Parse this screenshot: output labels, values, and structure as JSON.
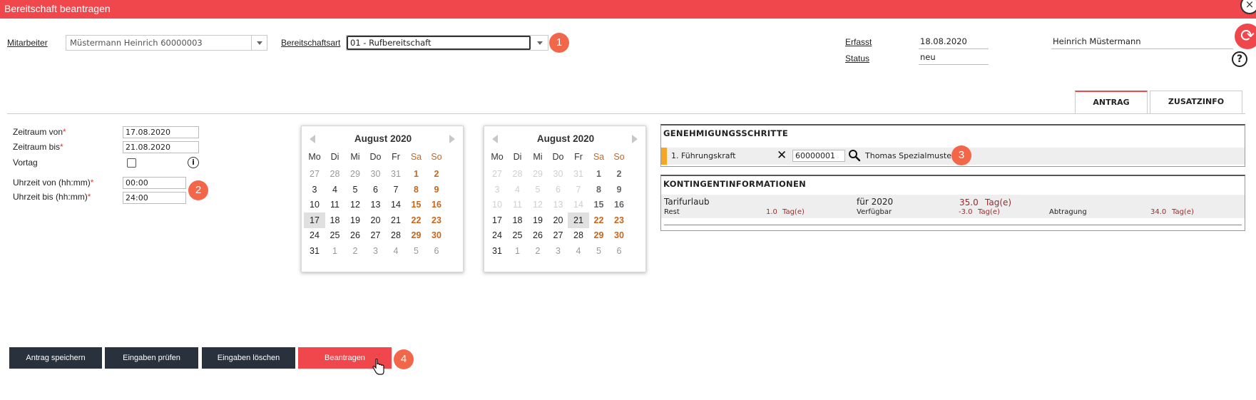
{
  "window": {
    "title": "Bereitschaft beantragen",
    "close_glyph": "×",
    "refresh_glyph": "⟳",
    "help_glyph": "?"
  },
  "header": {
    "mitarbeiter_label": "Mitarbeiter",
    "mitarbeiter_value": "Müstermann Heinrich 60000003",
    "art_label": "Bereitschaftsart",
    "art_value": "01 - Rufbereitschaft",
    "erfasst_label": "Erfasst",
    "erfasst_value": "18.08.2020",
    "status_label": "Status",
    "status_value": "neu",
    "user_name": "Heinrich Müstermann"
  },
  "badges": [
    "1",
    "2",
    "3",
    "4"
  ],
  "tabs": [
    {
      "label": "ANTRAG",
      "active": true
    },
    {
      "label": "ZUSATZINFO",
      "active": false
    }
  ],
  "form": {
    "zeitraum_von_label": "Zeitraum von",
    "zeitraum_von_value": "17.08.2020",
    "zeitraum_bis_label": "Zeitraum bis",
    "zeitraum_bis_value": "21.08.2020",
    "vortag_label": "Vortag",
    "uhrzeit_von_label": "Uhrzeit von (hh:mm)",
    "uhrzeit_von_value": "00:00",
    "uhrzeit_bis_label": "Uhrzeit bis (hh:mm)",
    "uhrzeit_bis_value": "24:00",
    "required_mark": "*",
    "info_glyph": "i"
  },
  "calendars": [
    {
      "title": "August 2020",
      "weekdays": [
        "Mo",
        "Di",
        "Mi",
        "Do",
        "Fr",
        "Sa",
        "So"
      ],
      "selected": [
        17
      ],
      "disabled_until": 0,
      "weeks": [
        [
          27,
          28,
          29,
          30,
          31,
          1,
          2
        ],
        [
          3,
          4,
          5,
          6,
          7,
          8,
          9
        ],
        [
          10,
          11,
          12,
          13,
          14,
          15,
          16
        ],
        [
          17,
          18,
          19,
          20,
          21,
          22,
          23
        ],
        [
          24,
          25,
          26,
          27,
          28,
          29,
          30
        ],
        [
          31,
          1,
          2,
          3,
          4,
          5,
          6
        ]
      ]
    },
    {
      "title": "August 2020",
      "weekdays": [
        "Mo",
        "Di",
        "Mi",
        "Do",
        "Fr",
        "Sa",
        "So"
      ],
      "selected": [
        21
      ],
      "disabled_until": 17,
      "weeks": [
        [
          27,
          28,
          29,
          30,
          31,
          1,
          2
        ],
        [
          3,
          4,
          5,
          6,
          7,
          8,
          9
        ],
        [
          10,
          11,
          12,
          13,
          14,
          15,
          16
        ],
        [
          17,
          18,
          19,
          20,
          21,
          22,
          23
        ],
        [
          24,
          25,
          26,
          27,
          28,
          29,
          30
        ],
        [
          31,
          1,
          2,
          3,
          4,
          5,
          6
        ]
      ]
    }
  ],
  "genehmigung": {
    "title": "GENEHMIGUNGSSCHRITTE",
    "step_label": "1. Führungskraft",
    "clear_glyph": "✕",
    "id_value": "60000001",
    "person": "Thomas Spezialmuster",
    "accent": "#f5a623"
  },
  "kontingent": {
    "title": "KONTINGENTINFORMATIONEN",
    "tarif_label": "Tarifurlaub",
    "fuer_label": "für 2020",
    "fuer_value": "35.0",
    "fuer_unit": "Tag(e)",
    "rest_label": "Rest",
    "rest_value": "1.0",
    "rest_unit": "Tag(e)",
    "verf_label": "Verfügbar",
    "verf_value": "-3.0",
    "verf_unit": "Tag(e)",
    "abtr_label": "Abtragung",
    "abtr_value": "34.0",
    "abtr_unit": "Tag(e)"
  },
  "buttons": {
    "save": "Antrag speichern",
    "check": "Eingaben prüfen",
    "clear": "Eingaben löschen",
    "submit": "Beantragen"
  },
  "colors": {
    "brand": "#f0474c",
    "badge": "#f2664a",
    "weekend": "#c9651a",
    "dark_button": "#29323c"
  }
}
